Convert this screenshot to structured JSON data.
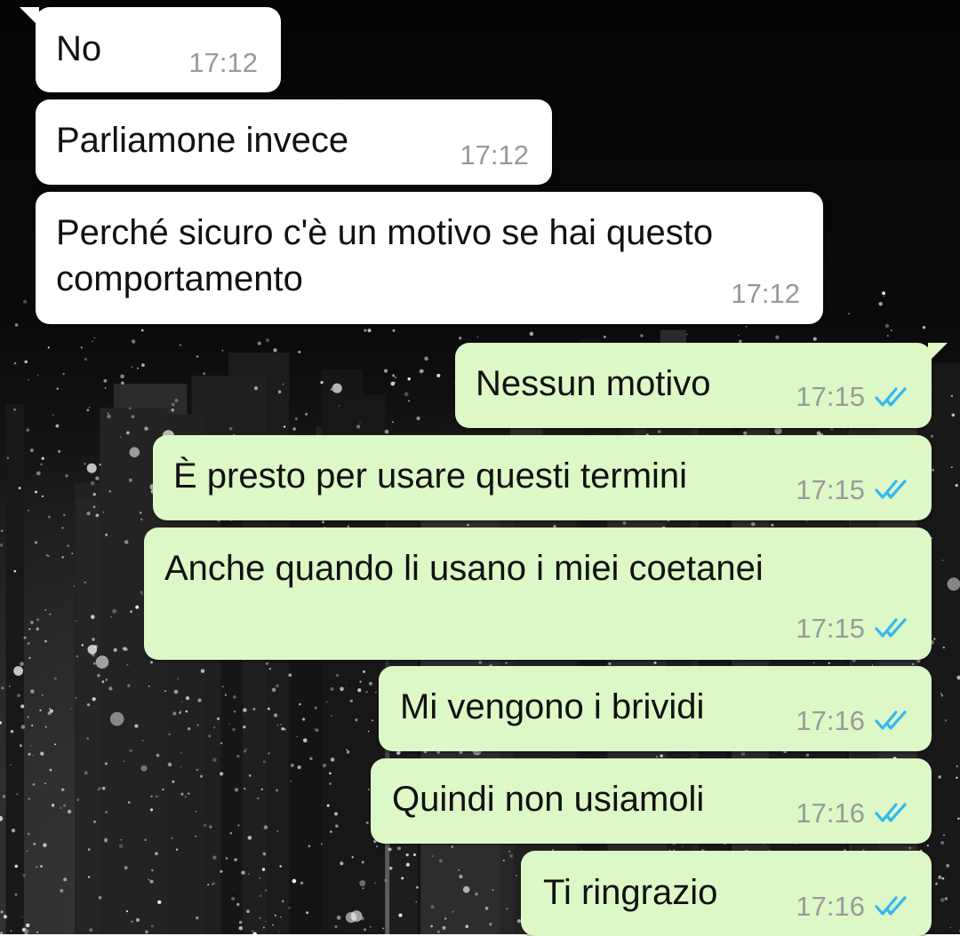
{
  "colors": {
    "incoming_bubble": "#ffffff",
    "outgoing_bubble": "#dcf8c6",
    "read_ticks": "#34b7f1",
    "timestamp": "#9a9a9a"
  },
  "messages": [
    {
      "direction": "incoming",
      "lines": [
        "No"
      ],
      "time": "17:12"
    },
    {
      "direction": "incoming",
      "lines": [
        "Parliamone invece"
      ],
      "time": "17:12"
    },
    {
      "direction": "incoming",
      "lines": [
        "Perché sicuro c'è un motivo se hai questo",
        "comportamento"
      ],
      "time": "17:12"
    },
    {
      "direction": "outgoing",
      "lines": [
        "Nessun motivo"
      ],
      "time": "17:15",
      "status": "read-double-check-icon"
    },
    {
      "direction": "outgoing",
      "lines": [
        "È presto per usare questi termini"
      ],
      "time": "17:15",
      "status": "read-double-check-icon"
    },
    {
      "direction": "outgoing",
      "lines": [
        "Anche quando li usano i miei coetanei"
      ],
      "time": "17:15",
      "status": "read-double-check-icon"
    },
    {
      "direction": "outgoing",
      "lines": [
        "Mi vengono i brividi"
      ],
      "time": "17:16",
      "status": "read-double-check-icon"
    },
    {
      "direction": "outgoing",
      "lines": [
        "Quindi non usiamoli"
      ],
      "time": "17:16",
      "status": "read-double-check-icon"
    },
    {
      "direction": "outgoing",
      "lines": [
        "Ti ringrazio"
      ],
      "time": "17:16",
      "status": "read-double-check-icon"
    }
  ]
}
